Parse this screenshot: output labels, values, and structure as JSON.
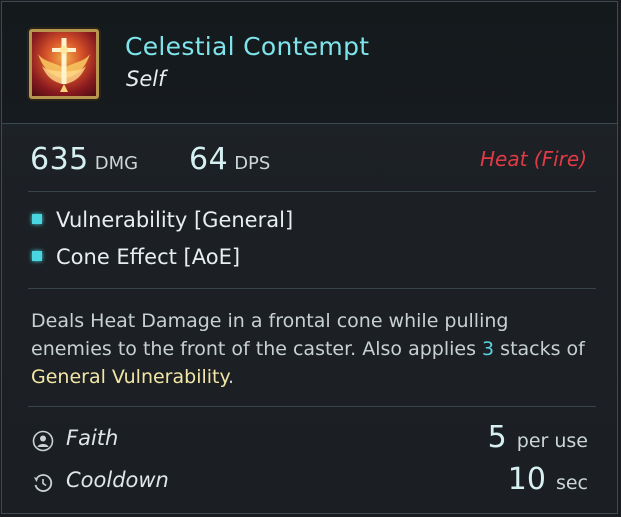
{
  "ability": {
    "icon": "winged-cross-flame-icon",
    "name": "Celestial Contempt",
    "target": "Self"
  },
  "stats": {
    "damage_value": "635",
    "damage_unit": "DMG",
    "dps_value": "64",
    "dps_unit": "DPS",
    "damage_type": "Heat (Fire)",
    "damage_type_color": "#e23a45"
  },
  "effects": [
    {
      "label": "Vulnerability [General]"
    },
    {
      "label": "Cone Effect [AoE]"
    }
  ],
  "description": {
    "part1": "Deals Heat Damage in a frontal cone while pulling enemies to the front of the caster. Also applies ",
    "stacks": "3",
    "part2": " stacks of ",
    "highlight": "General Vulnerability",
    "part3": "."
  },
  "costs": [
    {
      "icon": "faith-icon",
      "label": "Faith",
      "value": "5",
      "unit": "per use"
    },
    {
      "icon": "cooldown-icon",
      "label": "Cooldown",
      "value": "10",
      "unit": "sec"
    }
  ],
  "colors": {
    "title": "#7ee3ea",
    "accent_bullet": "#49d6e0",
    "highlight_text": "#f2e6a6"
  }
}
